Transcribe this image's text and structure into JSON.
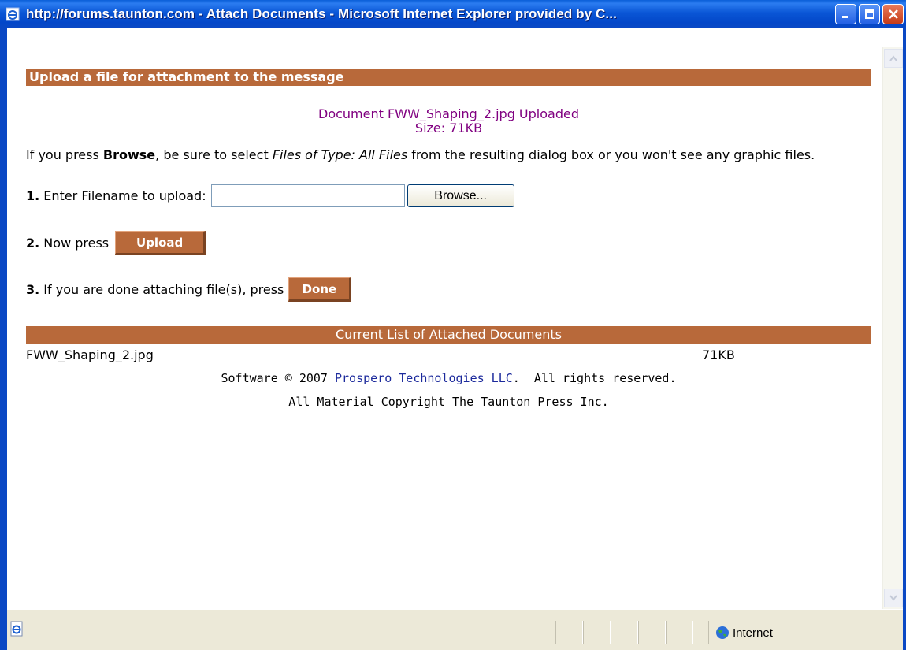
{
  "window": {
    "title": "http://forums.taunton.com - Attach Documents - Microsoft Internet Explorer provided by C..."
  },
  "page": {
    "header": "Upload a file for attachment to the message",
    "upload_status_line1": "Document FWW_Shaping_2.jpg Uploaded",
    "upload_status_line2": "Size: 71KB",
    "instr_pre": "If you press ",
    "instr_browse": "Browse",
    "instr_mid": ", be sure to select ",
    "instr_filetype": "Files of Type: All Files",
    "instr_post": " from the resulting dialog box or you won't see any graphic files.",
    "step1_num": "1.",
    "step1_label": " Enter Filename to upload:",
    "file_input_value": "",
    "browse_button": "Browse...",
    "step2_num": "2.",
    "step2_label": " Now press",
    "upload_button": "Upload",
    "step3_num": "3.",
    "step3_label": " If you are done attaching file(s), press",
    "done_button": "Done",
    "list_header": "Current List of Attached Documents",
    "attachments": [
      {
        "name": "FWW_Shaping_2.jpg",
        "size": "71KB"
      }
    ],
    "footer_prefix": "Software © 2007 ",
    "footer_link": "Prospero Technologies LLC",
    "footer_suffix": ".  All rights reserved.",
    "footer_line2": "All Material Copyright The Taunton Press Inc."
  },
  "statusbar": {
    "zone": "Internet"
  },
  "colors": {
    "accent_brown": "#b8693a",
    "status_purple": "#800080",
    "link_blue": "#1c2a9c",
    "titlebar_blue": "#0a56d6"
  },
  "icons": {
    "title_icon": "ie-page-icon",
    "minimize": "minimize-icon",
    "maximize": "maximize-icon",
    "close": "close-icon",
    "status_page": "ie-page-icon",
    "zone": "globe-icon"
  }
}
